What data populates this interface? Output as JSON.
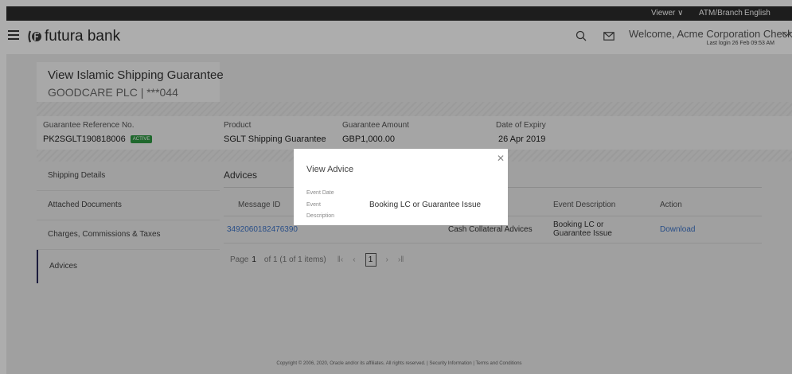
{
  "topbar": {
    "viewer": "Viewer",
    "atm_branch": "ATM/Branch",
    "language": "English"
  },
  "header": {
    "brand": "futura bank",
    "welcome": "Welcome, Acme Corporation Checker",
    "last_login": "Last login 26 Feb 09:53 AM"
  },
  "page": {
    "title": "View Islamic Shipping Guarantee",
    "subtitle": "GOODCARE PLC | ***044"
  },
  "summary": {
    "ref_label": "Guarantee Reference No.",
    "ref_value": "PK2SGLT190818006",
    "status": "ACTIVE",
    "product_label": "Product",
    "product_value": "SGLT Shipping Guarantee",
    "amount_label": "Guarantee Amount",
    "amount_value": "GBP1,000.00",
    "expiry_label": "Date of Expiry",
    "expiry_value": "26 Apr 2019"
  },
  "sidenav": {
    "items": [
      {
        "label": "Shipping Details"
      },
      {
        "label": "Attached Documents"
      },
      {
        "label": "Charges, Commissions & Taxes"
      },
      {
        "label": "Advices"
      }
    ]
  },
  "advices": {
    "title": "Advices",
    "headers": [
      "Message ID",
      "Event Description",
      "Action"
    ],
    "rows": [
      {
        "message_id": "3492060182476390",
        "advice_name": "Cash Collateral Advices",
        "event_description": "Booking LC or Guarantee Issue",
        "action": "Download"
      }
    ]
  },
  "pager": {
    "page_label": "Page",
    "page": "1",
    "of_text": "of 1  (1 of 1 items)",
    "current": "1"
  },
  "footer": "Copyright © 2006, 2020, Oracle and/or its affiliates. All rights reserved. | Security Information | Terms and Conditions",
  "modal": {
    "title": "View Advice",
    "event_date_label": "Event Date",
    "event_label_1": "Event",
    "event_label_2": "Description",
    "event_value": "Booking LC or Guarantee Issue"
  },
  "colors": {
    "active_badge": "#2e9a43",
    "link": "#3b73c8",
    "topbar": "#2b2b2b"
  }
}
